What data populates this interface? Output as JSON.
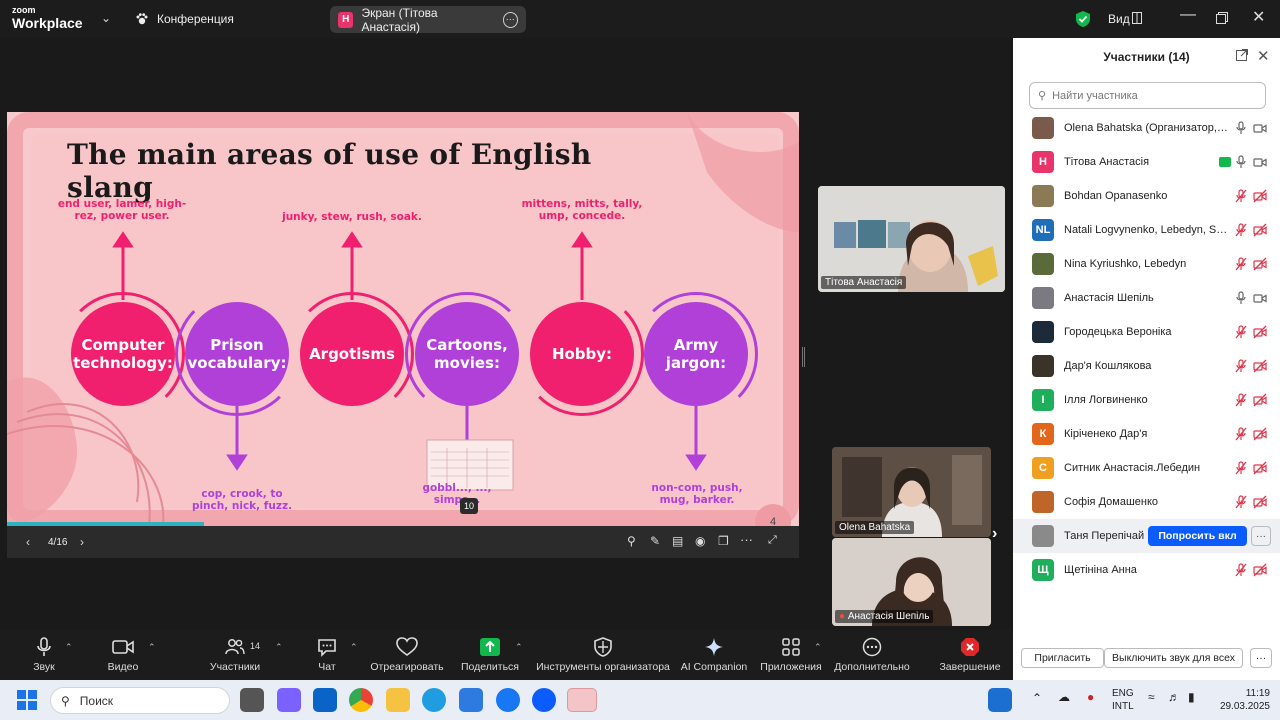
{
  "app": {
    "logo_top": "zoom",
    "logo_bottom": "Workplace",
    "meeting_title": "Конференция",
    "screen_share_label": "Экран (Тітова Анастасія)",
    "screen_share_avatar": "Н",
    "view_label": "Вид"
  },
  "slide": {
    "title": "The main areas of use of English slang",
    "topics": [
      {
        "label": "Computer technology:",
        "examples": "end user, lamer, high-rez, power user."
      },
      {
        "label": "Prison vocabulary:",
        "examples": "cop, crook, to pinch, nick, fuzz."
      },
      {
        "label": "Argotisms",
        "examples": "junky, stew, rush, soak."
      },
      {
        "label": "Cartoons, movies:",
        "examples": "gobbl..., ..., simps..."
      },
      {
        "label": "Hobby:",
        "examples": "mittens, mitts, tally, ump, concede."
      },
      {
        "label": "Army jargon:",
        "examples": "non-com, push, mug, barker."
      }
    ],
    "page_indicator": "4/16",
    "badge_10": "10",
    "badge_4": "4"
  },
  "tiles": [
    {
      "name": "Тітова Анастасія"
    },
    {
      "name": "Olena Bahatska"
    },
    {
      "name": "Анастасія Шепіль"
    }
  ],
  "participants_panel": {
    "title": "Участники (14)",
    "search_placeholder": "Найти участника",
    "participants": [
      {
        "name": "Olena Bahatska (Организатор, я)",
        "avatar": "",
        "color": "#7a5a4a",
        "muted": false
      },
      {
        "name": "Тітова Анастасія",
        "avatar": "Н",
        "color": "#e8336b",
        "muted": false
      },
      {
        "name": "Bohdan Opanasenko",
        "avatar": "",
        "color": "#8a7a55",
        "muted": true
      },
      {
        "name": "Natali Logvynenko, Lebedyn, Sum...",
        "avatar": "NL",
        "color": "#1e6fb8",
        "muted": true
      },
      {
        "name": "Nina Kyriushko, Lebedyn",
        "avatar": "",
        "color": "#5a6a3a",
        "muted": true
      },
      {
        "name": "Анастасія Шепіль",
        "avatar": "",
        "color": "#7a7a80",
        "muted": false
      },
      {
        "name": "Городецька Вероніка",
        "avatar": "",
        "color": "#1c2a3a",
        "muted": true
      },
      {
        "name": "Дар'я Кошлякова",
        "avatar": "",
        "color": "#3a3328",
        "muted": true
      },
      {
        "name": "Ілля Логвиненко",
        "avatar": "І",
        "color": "#1fae5b",
        "muted": true
      },
      {
        "name": "Кіріченеко Дар'я",
        "avatar": "К",
        "color": "#e2661b",
        "muted": true
      },
      {
        "name": "Ситник Анастасія.Лебедин",
        "avatar": "С",
        "color": "#f0a020",
        "muted": true
      },
      {
        "name": "Софія Домашенко",
        "avatar": "",
        "color": "#c0652a",
        "muted": true
      },
      {
        "name": "Таня Перепічай",
        "avatar": "",
        "color": "#8a8a8a",
        "muted": true
      },
      {
        "name": "Щетініна Анна",
        "avatar": "Щ",
        "color": "#1fae5b",
        "muted": true
      }
    ],
    "ask_unmute_label": "Попросить вкл",
    "more_label": "···",
    "invite_label": "Пригласить",
    "unmute_all_label": "Выключить звук для всех"
  },
  "toolbar": {
    "audio": "Звук",
    "video": "Видео",
    "participants": "Участники",
    "participants_count": "14",
    "chat": "Чат",
    "react": "Отреагировать",
    "share": "Поделиться",
    "host_tools": "Инструменты организатора",
    "ai": "AI Companion",
    "apps": "Приложения",
    "more": "Дополнительно",
    "end": "Завершение"
  },
  "taskbar": {
    "search_placeholder": "Поиск",
    "lang_top": "ENG",
    "lang_bottom": "INTL",
    "time": "11:19",
    "date": "29.03.2025"
  },
  "colors": {
    "slide_bg": "#f7c9cc",
    "pink": "#f0206e",
    "purple": "#b040d8",
    "zoom_blue": "#0b5cff",
    "share_green": "#12b84c",
    "end_red": "#e02828"
  }
}
